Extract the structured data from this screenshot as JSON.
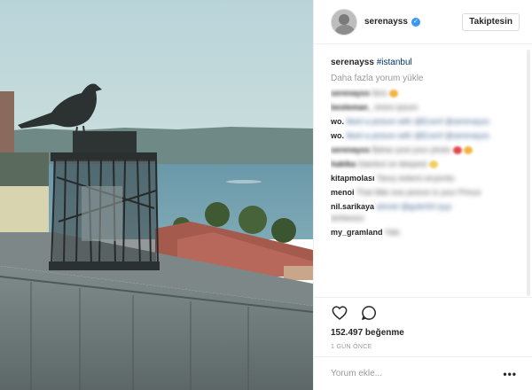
{
  "header": {
    "username": "serenayss",
    "follow_label": "Takiptesin"
  },
  "caption": {
    "username": "serenayss",
    "hashtag": "#istanbul"
  },
  "load_more": "Daha fazla yorum yükle",
  "comments": [
    {
      "user": "serenayss",
      "text": "fans",
      "emoji": "#f2b441",
      "blurred_user": true
    },
    {
      "user": "besteman_",
      "text": "",
      "blurred_user": true
    },
    {
      "user": "wo.",
      "text": "liked a picture with @Ecenf @serenayss",
      "blurred_user": false
    },
    {
      "user": "wo.",
      "text": "liked a picture with @Ecenf @serenayss",
      "blurred_user": false
    },
    {
      "user": "serenayss",
      "text": "Bahar post your photo",
      "emoji": "#e0484c",
      "blurred_user": true
    },
    {
      "user": "hakika",
      "text": "İstanbul ve deepest",
      "emoji": "#f2d060",
      "blurred_user": true
    },
    {
      "user": "kitapmolası",
      "text": "Tanış sistemi arıyordu",
      "blurred_user": true
    },
    {
      "user": "menoi",
      "text": "That little one picture is your Prince",
      "blurred_user": false
    },
    {
      "user": "nil.sarikaya",
      "text": "ahmet @guler54 iyyy",
      "extra": "terbiesizz",
      "blurred_user": false
    },
    {
      "user": "my_gramland",
      "text": "Yakı",
      "blurred_user": false
    }
  ],
  "actions": {
    "likes": "152.497 beğenme",
    "date": "1 GÜN ÖNCE",
    "comment_placeholder": "Yorum ekle...",
    "more_label": "•••"
  },
  "colors": {
    "link": "#003569",
    "verified": "#3897f0",
    "muted": "#999999"
  },
  "icons": [
    "verified-badge-icon",
    "heart-icon",
    "comment-bubble-icon",
    "more-options-icon"
  ]
}
